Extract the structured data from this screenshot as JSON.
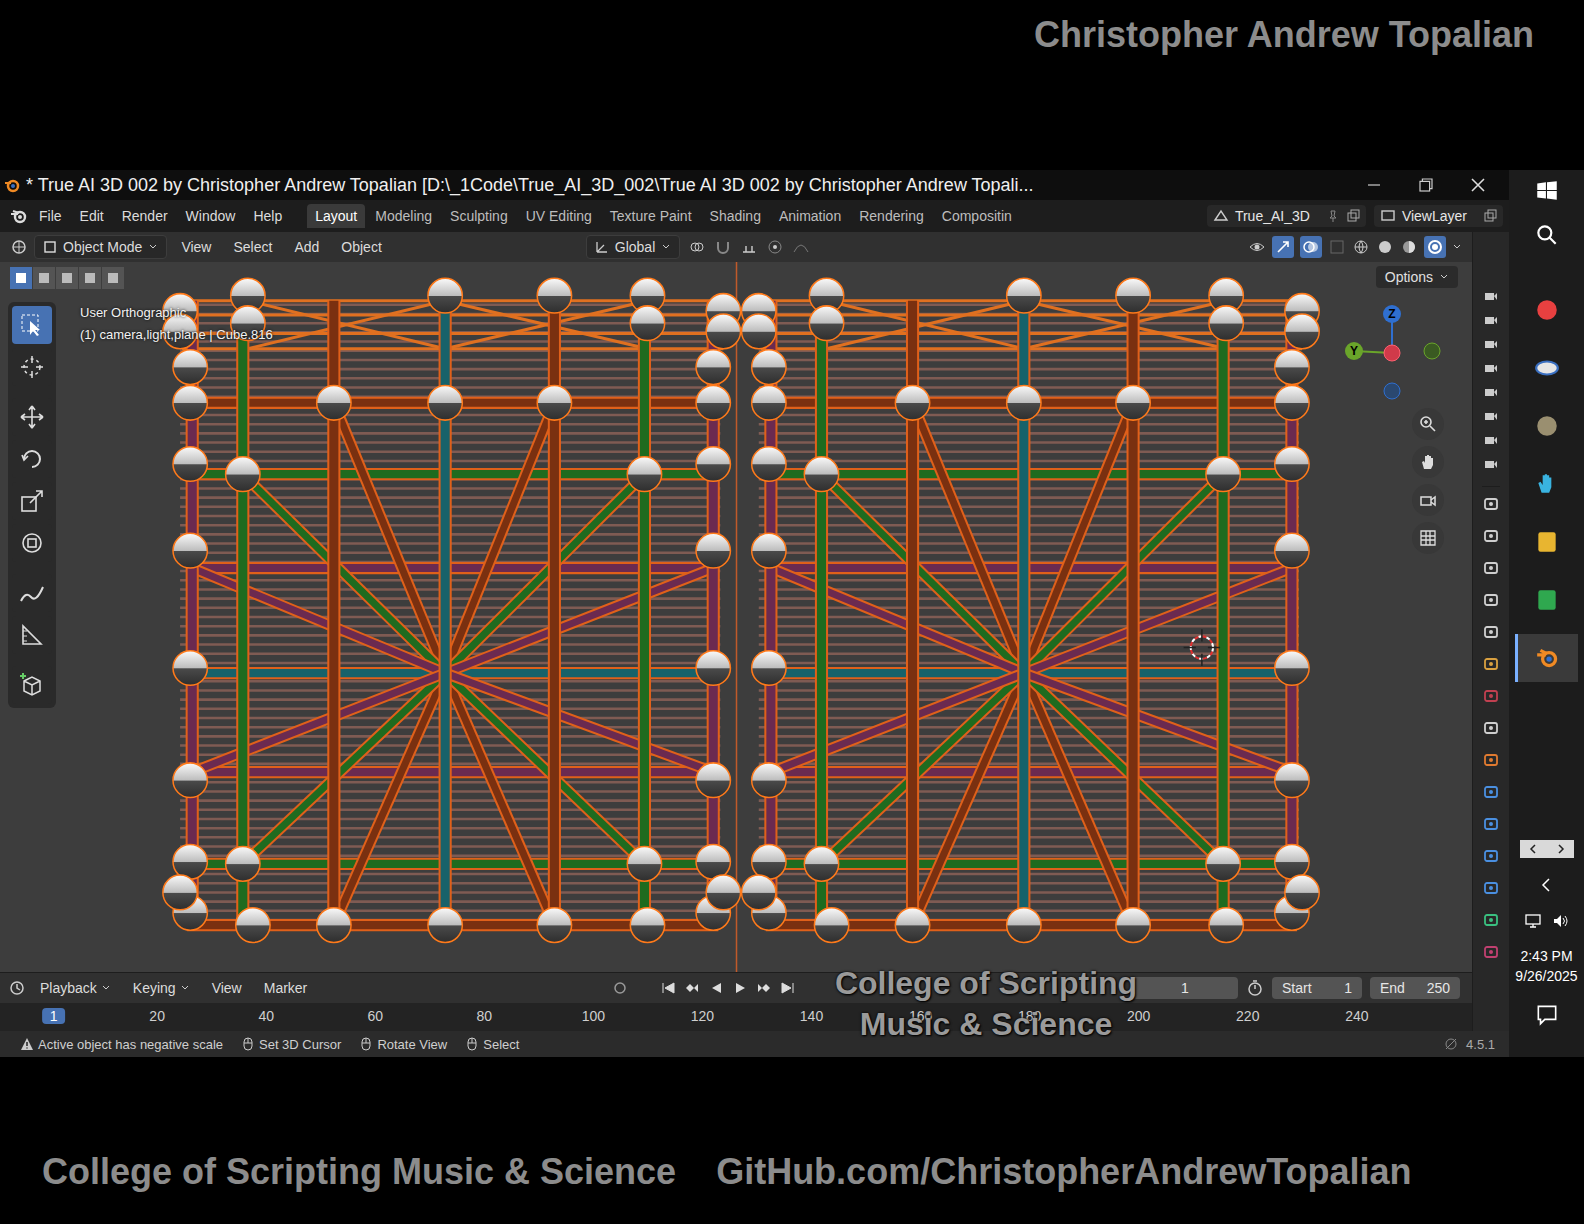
{
  "header_credit": "Christopher Andrew Topalian",
  "window": {
    "title": "* True AI 3D 002 by Christopher Andrew Topalian [D:\\_1Code\\True_AI_3D_002\\True AI 3D 002 by Christopher Andrew Topali..."
  },
  "menu": [
    "File",
    "Edit",
    "Render",
    "Window",
    "Help"
  ],
  "workspaces": [
    {
      "label": "Layout",
      "selected": true
    },
    {
      "label": "Modeling",
      "selected": false
    },
    {
      "label": "Sculpting",
      "selected": false
    },
    {
      "label": "UV Editing",
      "selected": false
    },
    {
      "label": "Texture Paint",
      "selected": false
    },
    {
      "label": "Shading",
      "selected": false
    },
    {
      "label": "Animation",
      "selected": false
    },
    {
      "label": "Rendering",
      "selected": false
    },
    {
      "label": "Compositin",
      "selected": false
    }
  ],
  "scene": "True_AI_3D",
  "view_layer": "ViewLayer",
  "viewport_header": {
    "mode": "Object Mode",
    "menus": [
      "View",
      "Select",
      "Add",
      "Object"
    ],
    "orientation": "Global"
  },
  "viewport": {
    "view_name": "User Orthographic",
    "selection_info": "(1) camera,light,plane | Cube.816",
    "options": "Options",
    "tools": [
      {
        "kind": "select",
        "selected": true
      },
      {
        "kind": "cursor",
        "selected": false
      },
      {
        "kind": "move",
        "selected": false
      },
      {
        "kind": "rotate",
        "selected": false
      },
      {
        "kind": "scale",
        "selected": false
      },
      {
        "kind": "transform",
        "selected": false
      },
      {
        "kind": "annotate",
        "selected": false
      },
      {
        "kind": "measure",
        "selected": false
      },
      {
        "kind": "add-cube",
        "selected": false
      }
    ],
    "select_modes": [
      {
        "selected": true
      },
      {
        "selected": false
      },
      {
        "selected": false
      },
      {
        "selected": false
      },
      {
        "selected": false
      }
    ],
    "gizmo_axes": [
      {
        "label": "Z",
        "color": "#2f6fd0"
      },
      {
        "label": "Y",
        "color": "#6aa52a"
      }
    ]
  },
  "timeline": {
    "menus": [
      "Playback",
      "Keying",
      "View",
      "Marker"
    ],
    "current_frame": "1",
    "start_label": "Start",
    "start": "1",
    "end_label": "End",
    "end": "250",
    "ruler": [
      {
        "label": "1",
        "selected": true
      },
      {
        "label": "20",
        "selected": false
      },
      {
        "label": "40",
        "selected": false
      },
      {
        "label": "60",
        "selected": false
      },
      {
        "label": "80",
        "selected": false
      },
      {
        "label": "100",
        "selected": false
      },
      {
        "label": "120",
        "selected": false
      },
      {
        "label": "140",
        "selected": false
      },
      {
        "label": "160",
        "selected": false
      },
      {
        "label": "180",
        "selected": false
      },
      {
        "label": "200",
        "selected": false
      },
      {
        "label": "220",
        "selected": false
      },
      {
        "label": "240",
        "selected": false
      }
    ]
  },
  "status_bar": {
    "hints": [
      {
        "kind": "warning",
        "text": "Active object has negative scale"
      },
      {
        "kind": "mouse",
        "text": "Set 3D Cursor"
      },
      {
        "kind": "mouse",
        "text": "Rotate View"
      },
      {
        "kind": "mouse",
        "text": "Select"
      }
    ],
    "version": "4.5.1"
  },
  "taskbar": {
    "time": "2:43 PM",
    "date": "9/26/2025"
  },
  "watermark": [
    "College of Scripting",
    "Music & Science"
  ],
  "footer": [
    "College of Scripting Music & Science",
    "GitHub.com/ChristopherAndrewTopalian"
  ]
}
